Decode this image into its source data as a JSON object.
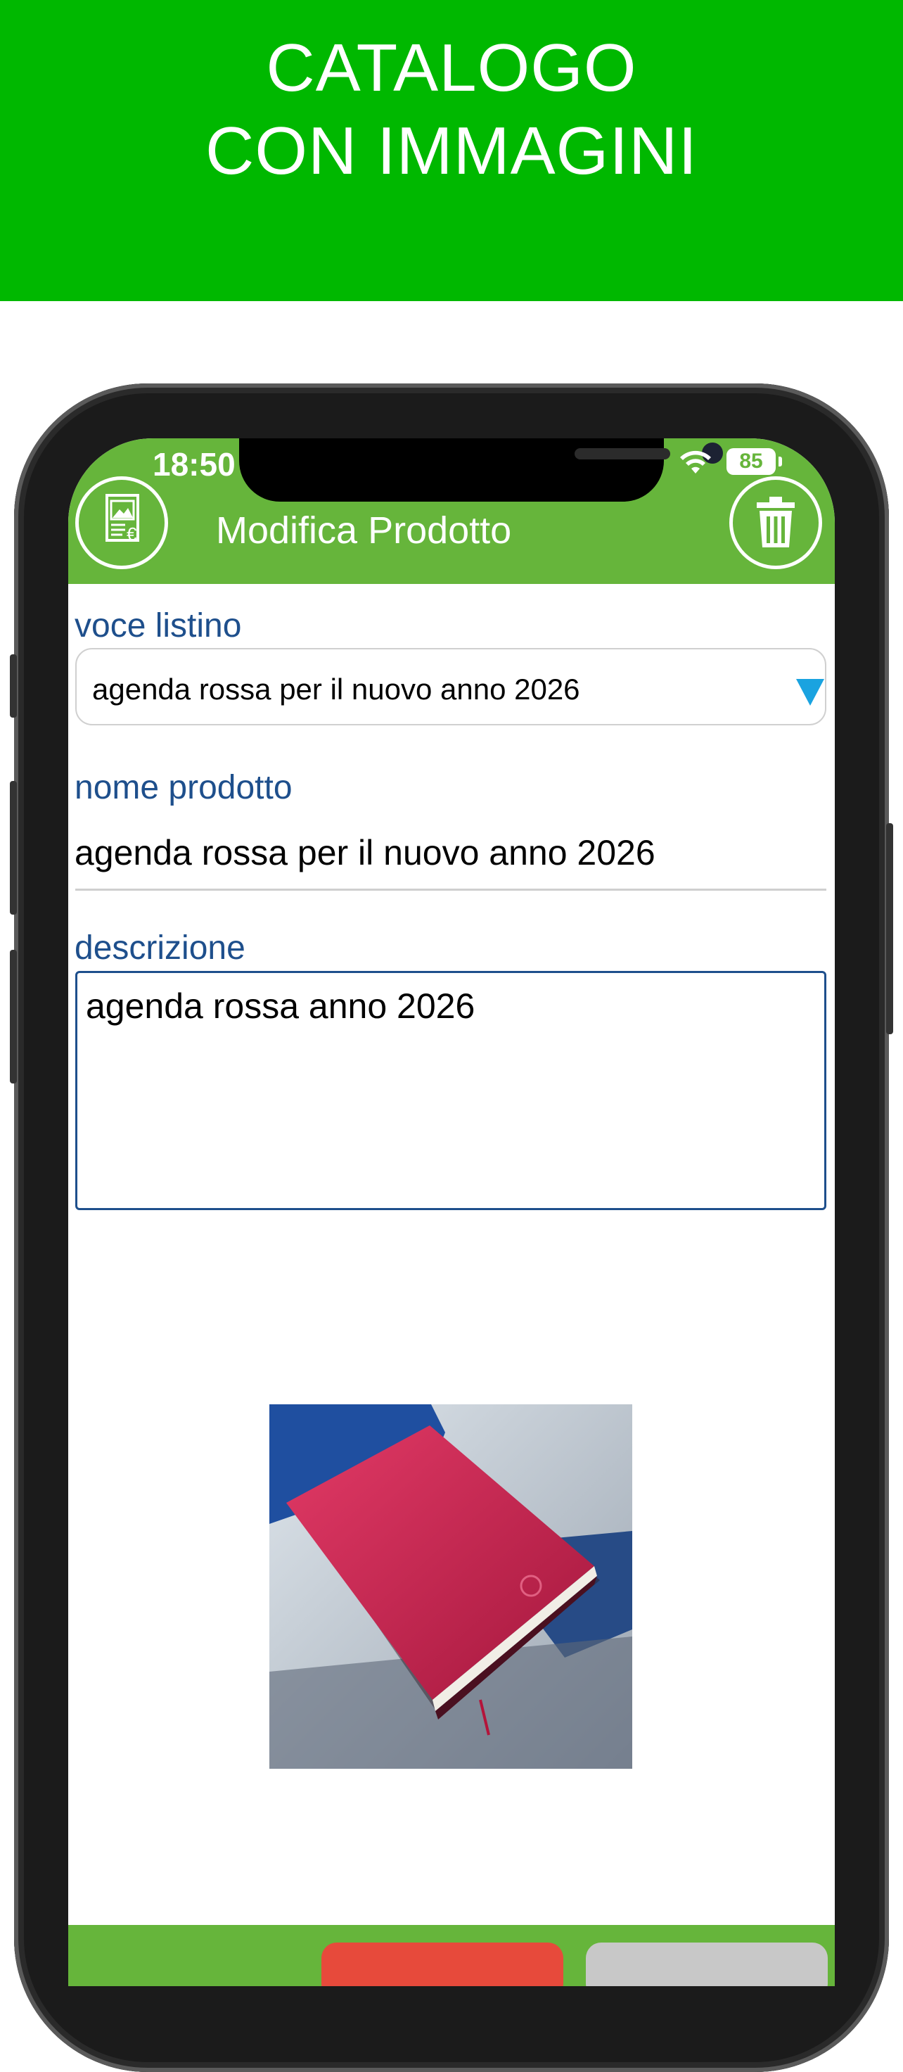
{
  "banner": {
    "line1": "CATALOGO",
    "line2": "CON IMMAGINI",
    "color": "#00b800"
  },
  "statusbar": {
    "time": "18:50",
    "battery": "85"
  },
  "header": {
    "title": "Modifica Prodotto",
    "left_icon": "catalog-image-euro-icon",
    "right_icon": "trash-icon",
    "color": "#66b53b"
  },
  "form": {
    "price_item_label": "voce listino",
    "price_item_value": "agenda rossa per il nuovo anno 2026",
    "product_name_label": "nome prodotto",
    "product_name_value": "agenda rossa per il nuovo anno 2026",
    "description_label": "descrizione",
    "description_value": "agenda rossa anno 2026",
    "label_color": "#1e4f8c",
    "dropdown_arrow_color": "#1aa3e0"
  },
  "image": {
    "subject": "red leather agenda photo"
  },
  "bottom_bar": {
    "left_button_color": "#e74a3b",
    "right_button_color": "#c8c8c8"
  }
}
